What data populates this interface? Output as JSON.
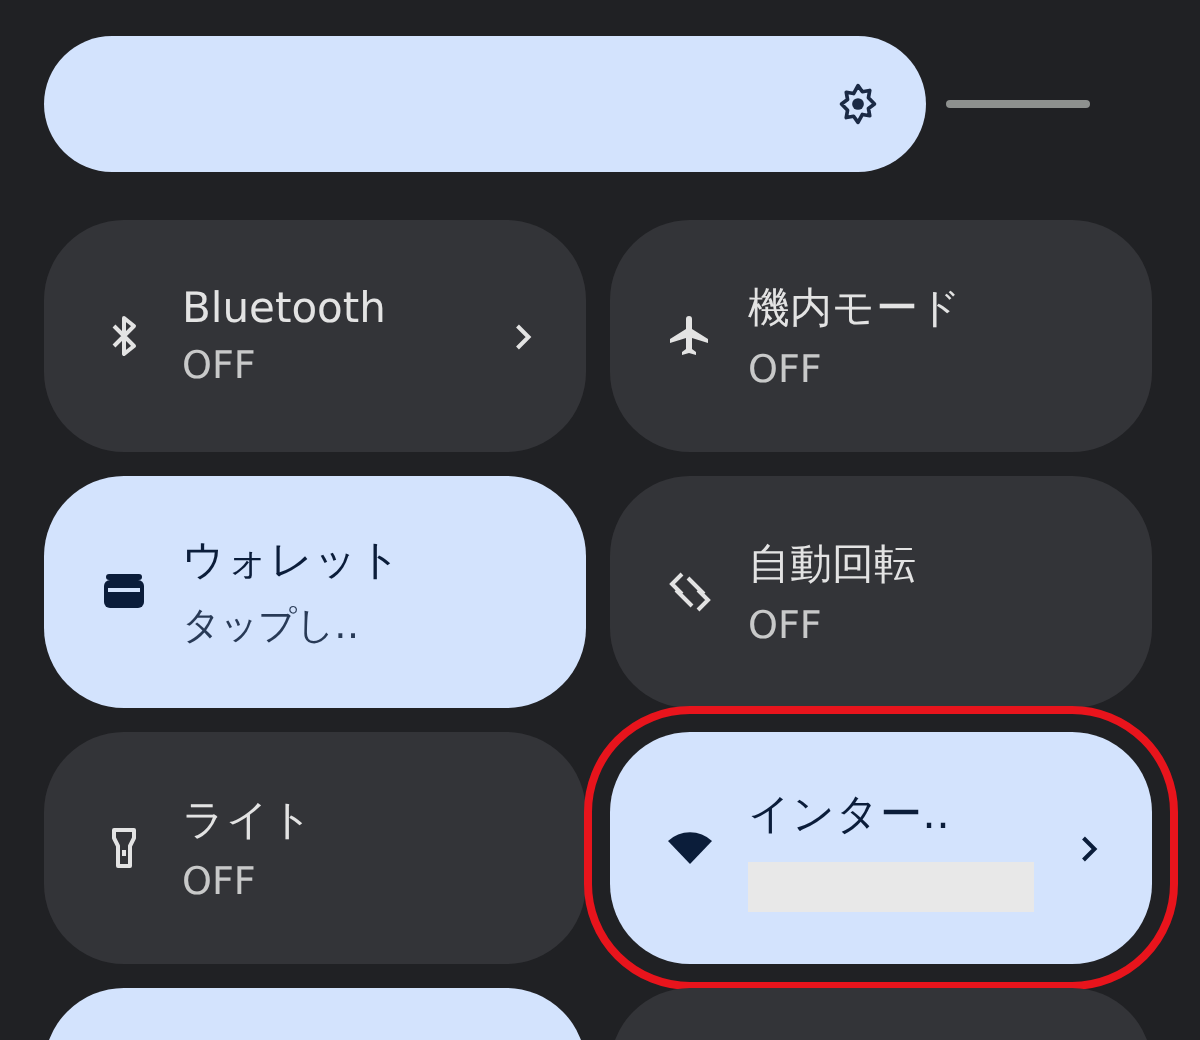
{
  "brightness": {
    "level": 0.843
  },
  "tiles": [
    {
      "title": "Bluetooth",
      "subtitle": "OFF",
      "active": false,
      "chevron": true,
      "highlighted": false,
      "redacted": false
    },
    {
      "title": "機内モード",
      "subtitle": "OFF",
      "active": false,
      "chevron": false,
      "highlighted": false,
      "redacted": false
    },
    {
      "title": "ウォレット",
      "subtitle": "タップし‥",
      "active": true,
      "chevron": false,
      "highlighted": false,
      "redacted": false
    },
    {
      "title": "自動回転",
      "subtitle": "OFF",
      "active": false,
      "chevron": false,
      "highlighted": false,
      "redacted": false
    },
    {
      "title": "ライト",
      "subtitle": "OFF",
      "active": false,
      "chevron": false,
      "highlighted": false,
      "redacted": false
    },
    {
      "title": "インター‥",
      "active": true,
      "chevron": true,
      "highlighted": true,
      "redacted": true
    }
  ],
  "partial_tiles": [
    {
      "active": true
    },
    {
      "active": false
    }
  ]
}
